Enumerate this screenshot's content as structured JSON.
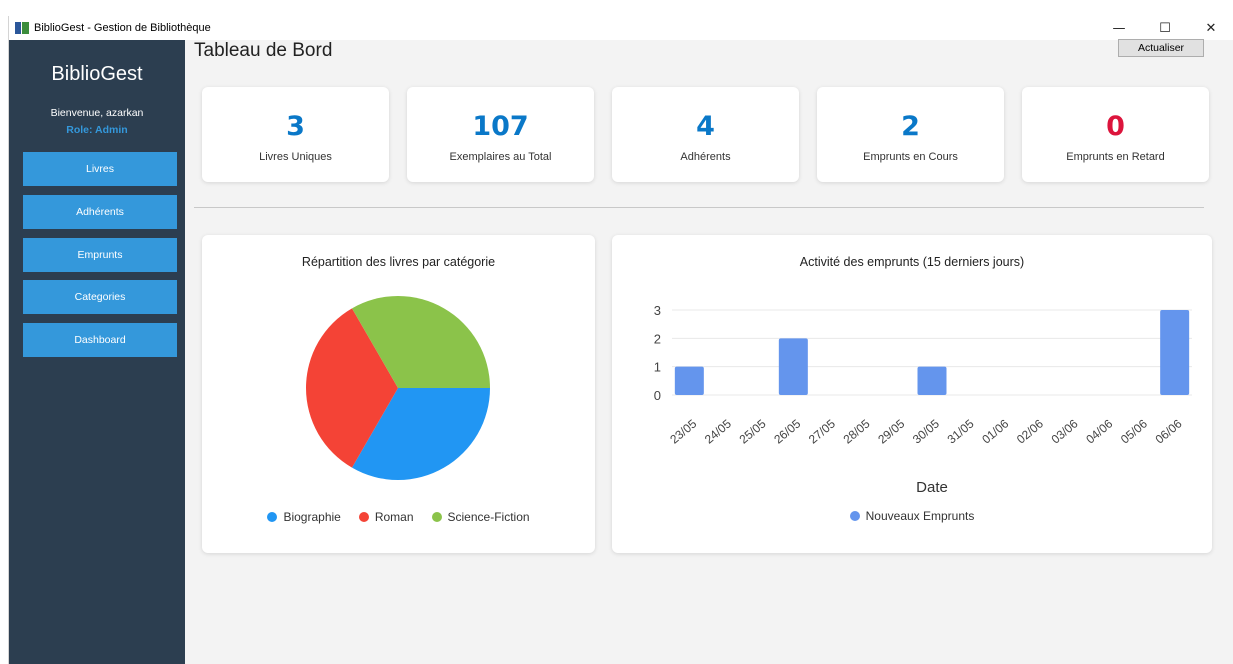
{
  "window": {
    "title": "BiblioGest - Gestion de Bibliothèque",
    "minimize_glyph": "—",
    "maximize_glyph": "☐",
    "close_glyph": "✕"
  },
  "sidebar": {
    "brand": "BiblioGest",
    "welcome": "Bienvenue, azarkan",
    "role": "Role: Admin",
    "items": [
      {
        "label": "Livres"
      },
      {
        "label": "Adhérents"
      },
      {
        "label": "Emprunts"
      },
      {
        "label": "Categories"
      },
      {
        "label": "Dashboard"
      }
    ]
  },
  "header": {
    "title": "Tableau de Bord",
    "refresh_label": "Actualiser"
  },
  "stats": [
    {
      "value": "3",
      "label": "Livres Uniques",
      "color": "#0a78c8"
    },
    {
      "value": "107",
      "label": "Exemplaires au Total",
      "color": "#0a78c8"
    },
    {
      "value": "4",
      "label": "Adhérents",
      "color": "#0a78c8"
    },
    {
      "value": "2",
      "label": "Emprunts en Cours",
      "color": "#0a78c8"
    },
    {
      "value": "0",
      "label": "Emprunts en Retard",
      "color": "#dc143c"
    }
  ],
  "chart_data": [
    {
      "type": "pie",
      "title": "Répartition des livres par catégorie",
      "legend_position": "bottom",
      "slices": [
        {
          "name": "Biographie",
          "value": 1,
          "color": "#2196f3"
        },
        {
          "name": "Roman",
          "value": 1,
          "color": "#f44336"
        },
        {
          "name": "Science-Fiction",
          "value": 1,
          "color": "#8bc34a"
        }
      ]
    },
    {
      "type": "bar",
      "title": "Activité des emprunts (15 derniers jours)",
      "xlabel": "Date",
      "ylabel": "",
      "ylim": [
        0,
        3
      ],
      "yticks": [
        0,
        1,
        2,
        3
      ],
      "grid": true,
      "legend_position": "bottom",
      "categories": [
        "23/05",
        "24/05",
        "25/05",
        "26/05",
        "27/05",
        "28/05",
        "29/05",
        "30/05",
        "31/05",
        "01/06",
        "02/06",
        "03/06",
        "04/06",
        "05/06",
        "06/06"
      ],
      "series": [
        {
          "name": "Nouveaux Emprunts",
          "color": "#6495ed",
          "values": [
            1,
            0,
            0,
            2,
            0,
            0,
            0,
            1,
            0,
            0,
            0,
            0,
            0,
            0,
            3
          ]
        }
      ]
    }
  ]
}
